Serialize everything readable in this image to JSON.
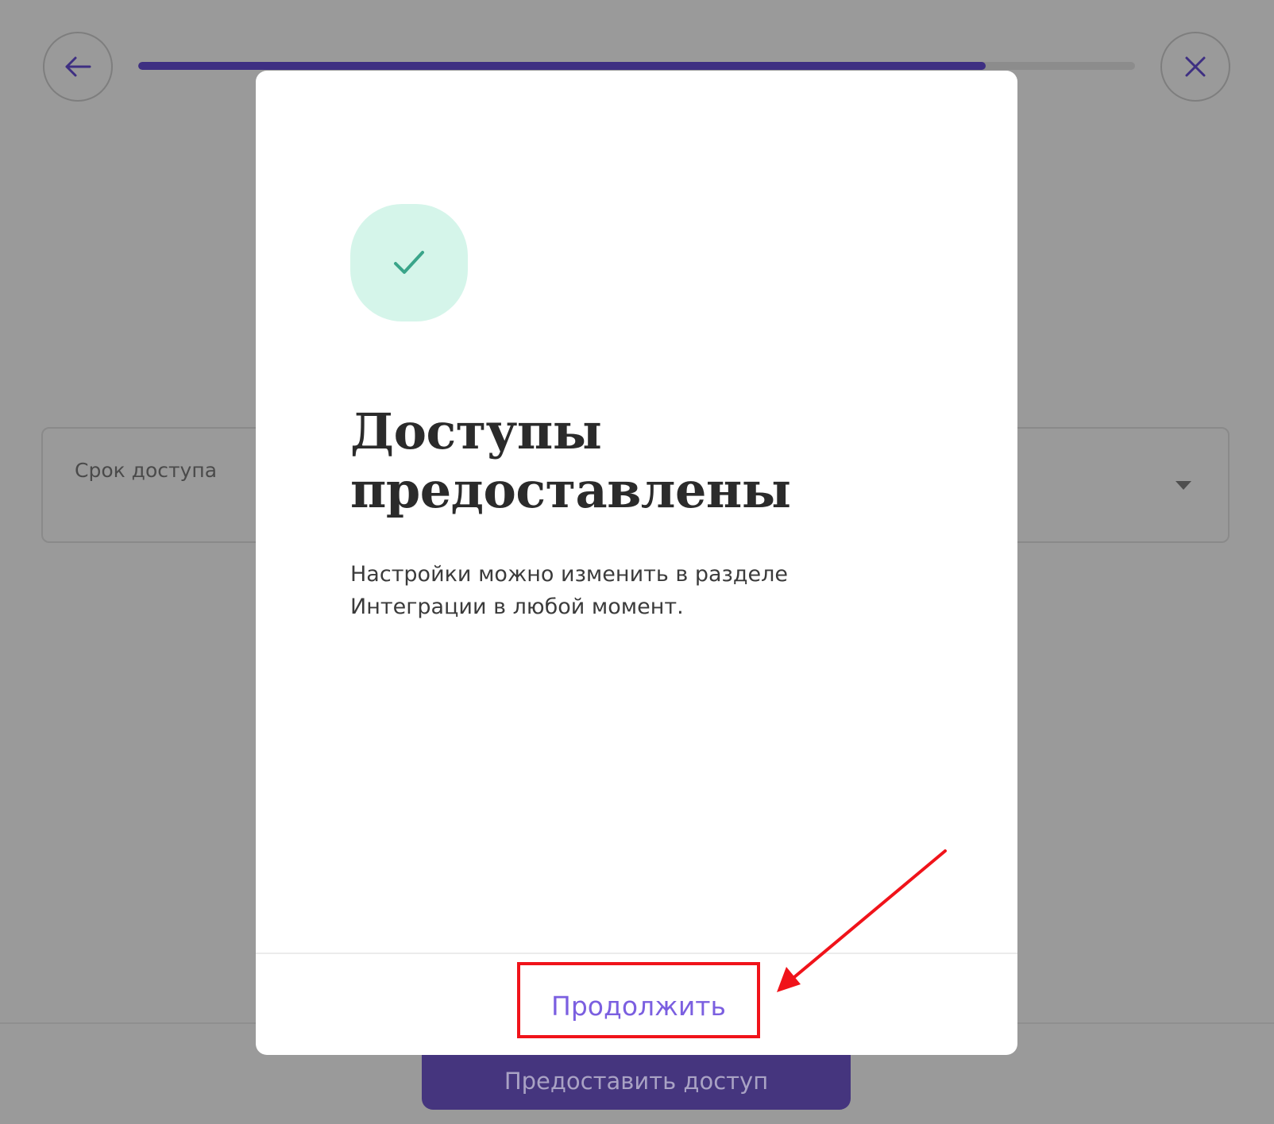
{
  "header": {
    "back_icon": "arrow-left-icon",
    "close_icon": "close-icon",
    "progress_percent": 85
  },
  "form": {
    "term_label": "Срок доступа",
    "term_value": ""
  },
  "footer": {
    "grant_label": "Предоставить доступ"
  },
  "modal": {
    "icon": "checkmark-icon",
    "title_line1": "Доступы",
    "title_line2": "предоставлены",
    "text_line1": "Настройки можно изменить в разделе",
    "text_line2": "Интеграции в любой момент.",
    "continue_label": "Продолжить"
  },
  "colors": {
    "overlay": "#9a9a9a",
    "accent": "#45357e",
    "link": "#7b5fe0",
    "success_bg": "#d5f5ea",
    "success_check": "#3aa58a",
    "annotation": "#f0131a"
  }
}
